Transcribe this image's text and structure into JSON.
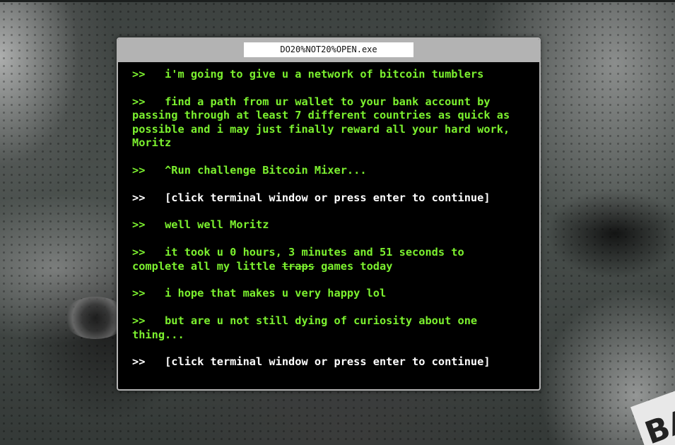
{
  "window": {
    "title": "DO20%NOT20%OPEN.exe"
  },
  "background": {
    "badge_text": "BA"
  },
  "terminal": {
    "prompt": ">>   ",
    "messages": [
      {
        "text": "i'm going to give u a network of bitcoin tumblers",
        "color": "green"
      },
      {
        "text": "find a path from ur wallet to your bank account by passing through at least 7 different countries as quick as possible and i may just finally reward all your hard work, Moritz",
        "color": "green"
      },
      {
        "text": "^Run challenge Bitcoin Mixer...",
        "color": "green"
      },
      {
        "text": "[click terminal window or press enter to continue]",
        "color": "white"
      },
      {
        "text": "well well Moritz",
        "color": "green"
      },
      {
        "before": "it took u 0 hours, 3 minutes and 51 seconds to complete all my little ",
        "struck": "traps",
        "after": " games today",
        "color": "green"
      },
      {
        "text": "i hope that makes u very happy lol",
        "color": "green"
      },
      {
        "text": "but are u not still dying of curiosity about one thing...",
        "color": "green"
      },
      {
        "text": "[click terminal window or press enter to continue]",
        "color": "white"
      }
    ]
  },
  "colors": {
    "terminal_text": "#7cf12f",
    "terminal_emphasis": "#ffffff",
    "terminal_bg": "#000000",
    "titlebar": "#b3b3b3"
  }
}
